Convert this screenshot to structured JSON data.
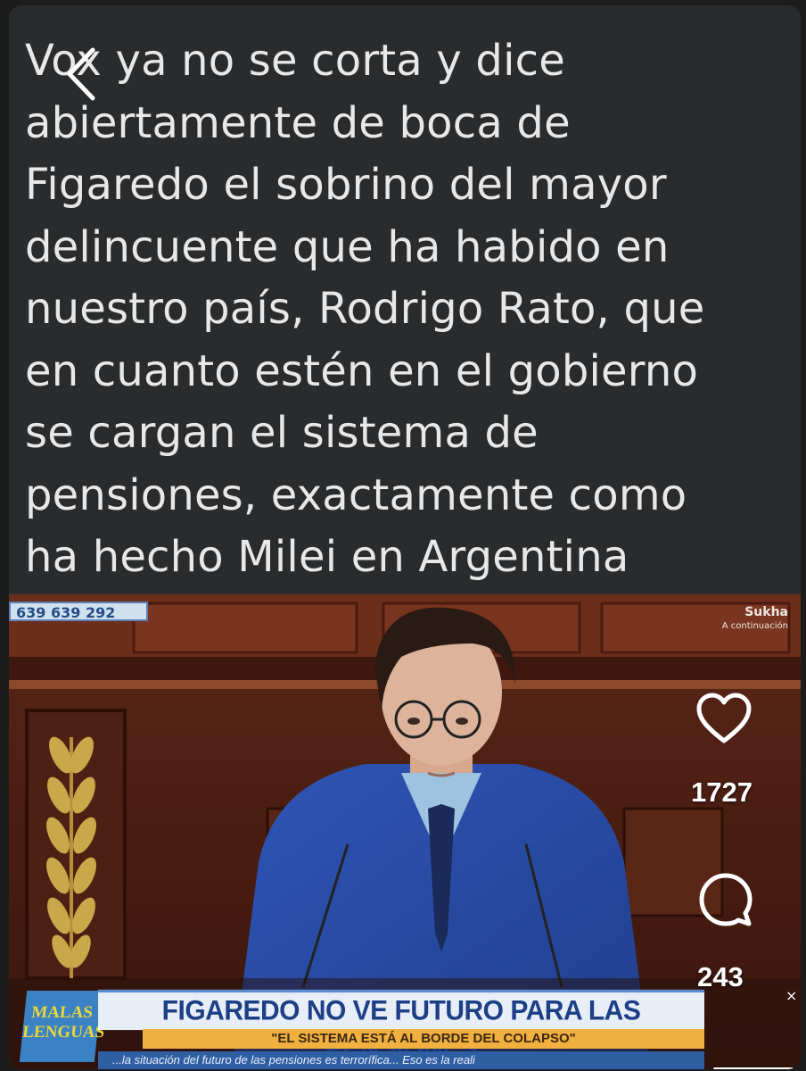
{
  "post": {
    "caption_lines": [
      "Vox ya no se corta y dice",
      "abiertamente de boca de",
      "Figaredo el sobrino del mayor",
      "delincuente que ha habido en",
      "nuestro país, Rodrigo Rato, que",
      "en cuanto estén en el gobierno",
      "se cargan el sistema de",
      "pensiones, exactamente como",
      "ha hecho Milei en Argentina"
    ]
  },
  "video": {
    "phone_badge": "639 639 292",
    "next_show_name": "Sukha",
    "next_show_sub": "A continuación",
    "logo_line1": "MALAS",
    "logo_line2": "LENGUAS",
    "headline": "FIGAREDO NO VE FUTURO PARA LAS PENSIONES",
    "subhead": "\"EL SISTEMA ESTÁ AL BORDE DEL COLAPSO\"",
    "ticker": "...la situación del futuro de las pensiones es terrorífica... Eso es la reali"
  },
  "actions": {
    "likes": "1727",
    "comments": "243",
    "like_icon": "heart-icon",
    "comment_icon": "comment-bubble-icon",
    "back_icon": "chevron-left-icon",
    "close_label": "×"
  },
  "colors": {
    "caption_bg": "#2a2b2c",
    "caption_text": "#e8e8e8",
    "headline_blue": "#1c3f86",
    "subhead_orange": "#f2b041"
  }
}
